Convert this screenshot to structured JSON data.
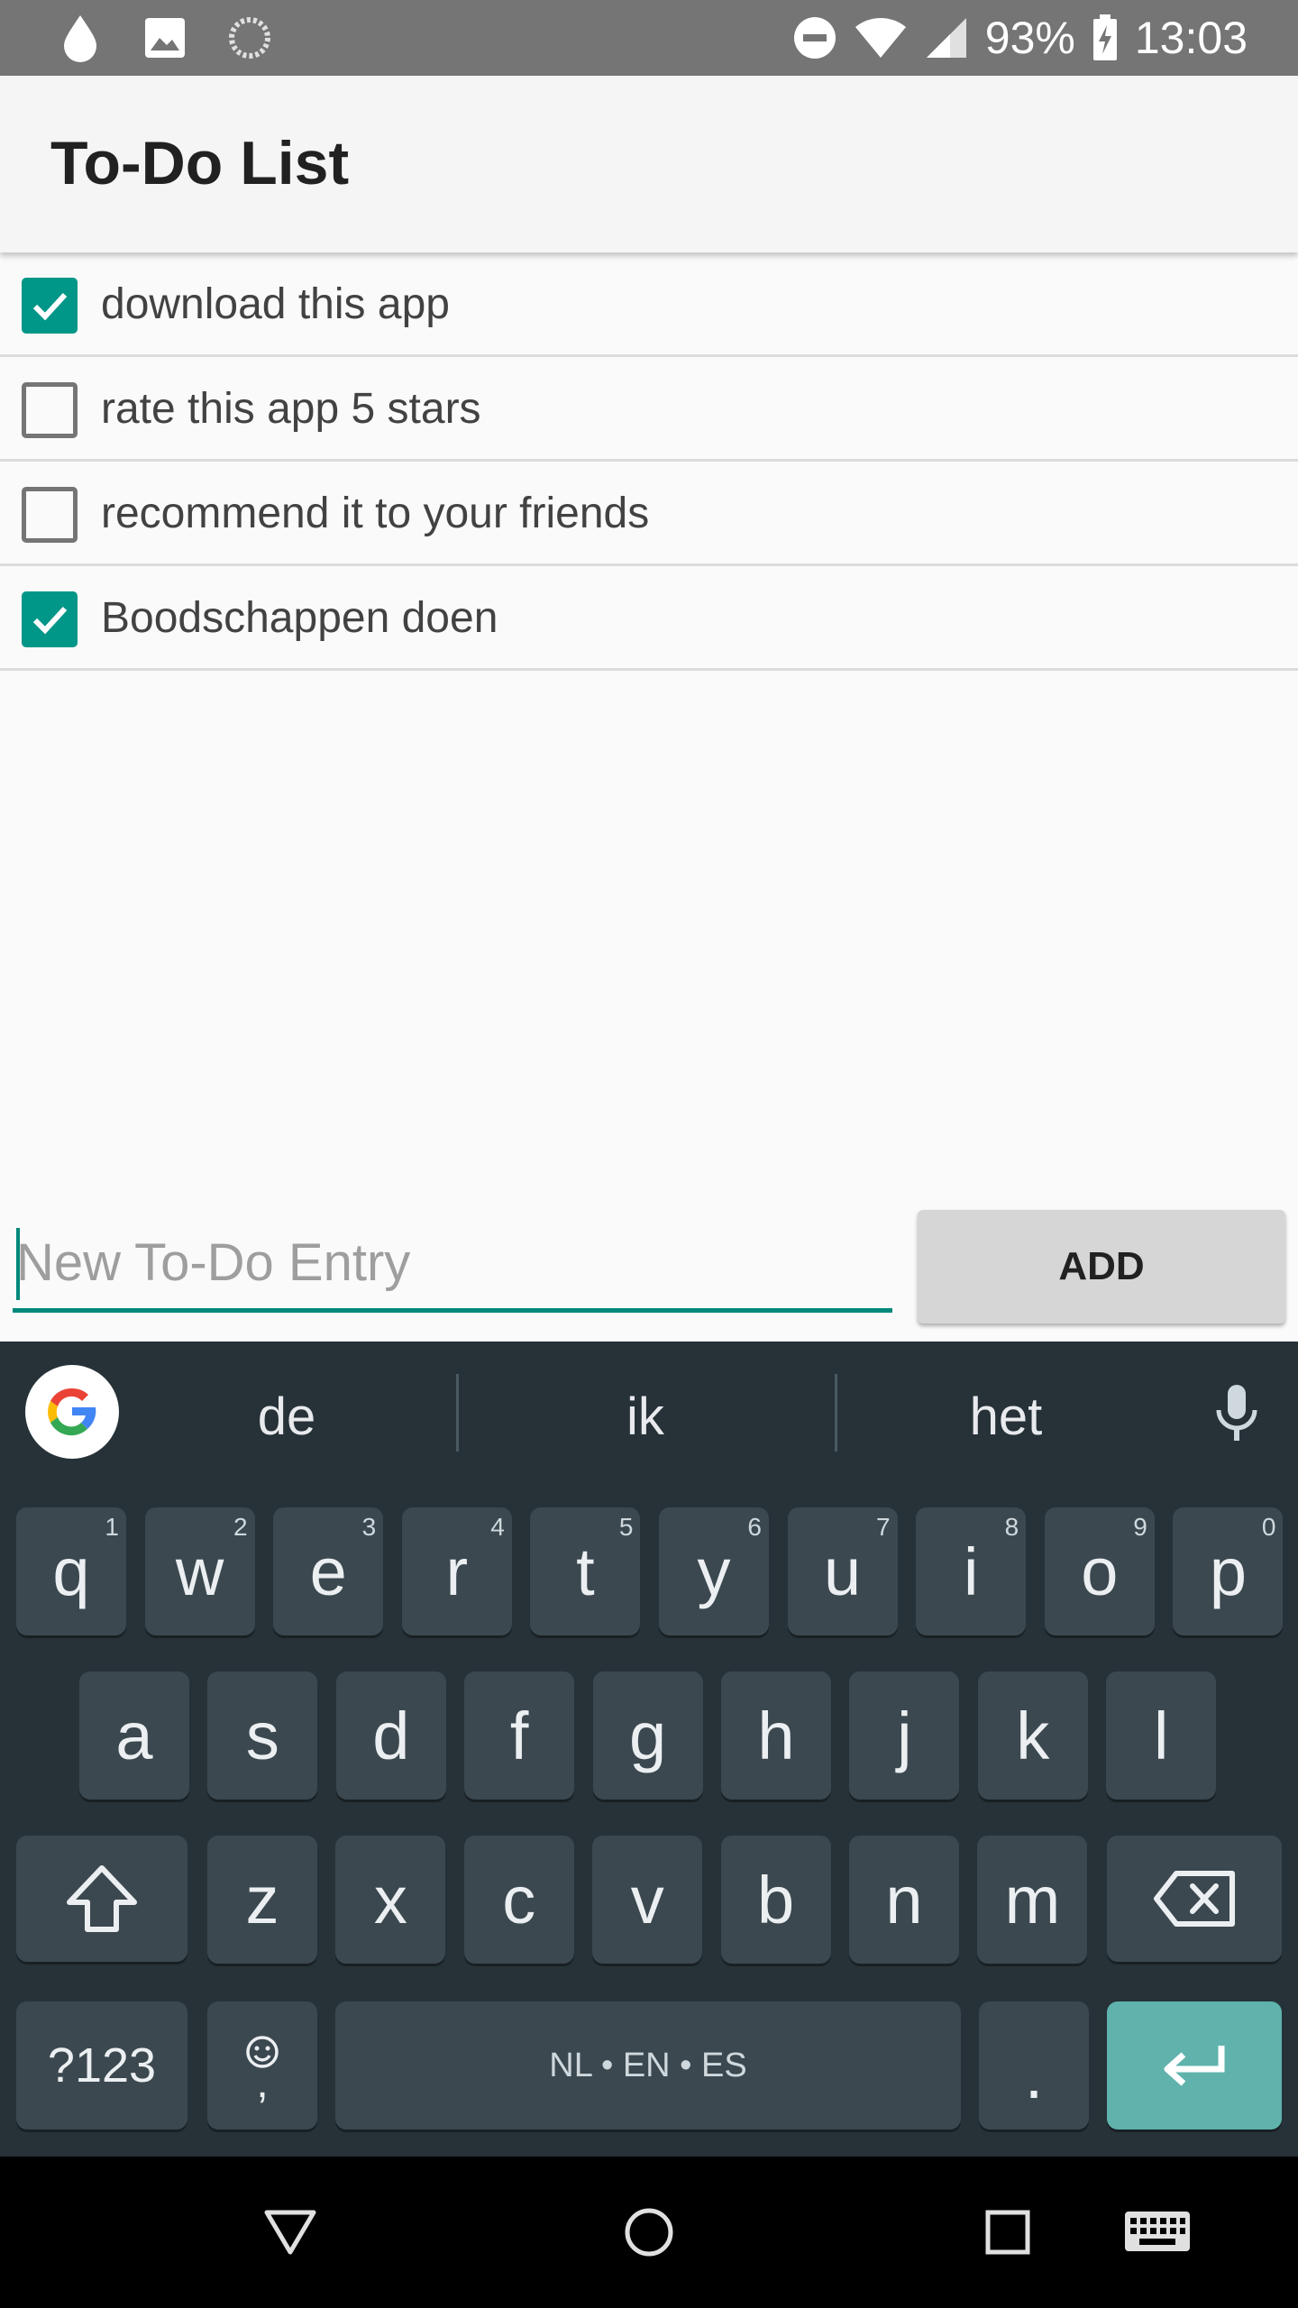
{
  "status_bar": {
    "battery": "93%",
    "time": "13:03",
    "icons": [
      "water-drop-icon",
      "image-icon",
      "sync-icon",
      "do-not-disturb-icon",
      "wifi-icon",
      "signal-icon",
      "battery-charging-icon"
    ]
  },
  "app": {
    "title": "To-Do List"
  },
  "todos": [
    {
      "label": "download this app",
      "checked": true
    },
    {
      "label": "rate this app 5 stars",
      "checked": false
    },
    {
      "label": "recommend it to your friends",
      "checked": false
    },
    {
      "label": "Boodschappen doen",
      "checked": true
    }
  ],
  "entry": {
    "placeholder": "New To-Do Entry",
    "value": ""
  },
  "add_button": {
    "label": "ADD"
  },
  "keyboard": {
    "suggestions": [
      "de",
      "ik",
      "het"
    ],
    "row1": [
      {
        "k": "q",
        "h": "1"
      },
      {
        "k": "w",
        "h": "2"
      },
      {
        "k": "e",
        "h": "3"
      },
      {
        "k": "r",
        "h": "4"
      },
      {
        "k": "t",
        "h": "5"
      },
      {
        "k": "y",
        "h": "6"
      },
      {
        "k": "u",
        "h": "7"
      },
      {
        "k": "i",
        "h": "8"
      },
      {
        "k": "o",
        "h": "9"
      },
      {
        "k": "p",
        "h": "0"
      }
    ],
    "row2": [
      "a",
      "s",
      "d",
      "f",
      "g",
      "h",
      "j",
      "k",
      "l"
    ],
    "row3": [
      "z",
      "x",
      "c",
      "v",
      "b",
      "n",
      "m"
    ],
    "symbols_label": "?123",
    "comma_label": ",",
    "space_label": "NL • EN • ES",
    "period_label": "."
  },
  "colors": {
    "accent": "#009688",
    "status_bar": "#757575",
    "keyboard_bg": "#263238",
    "key_bg": "#3b484f",
    "enter_key": "#5fb3ac"
  }
}
